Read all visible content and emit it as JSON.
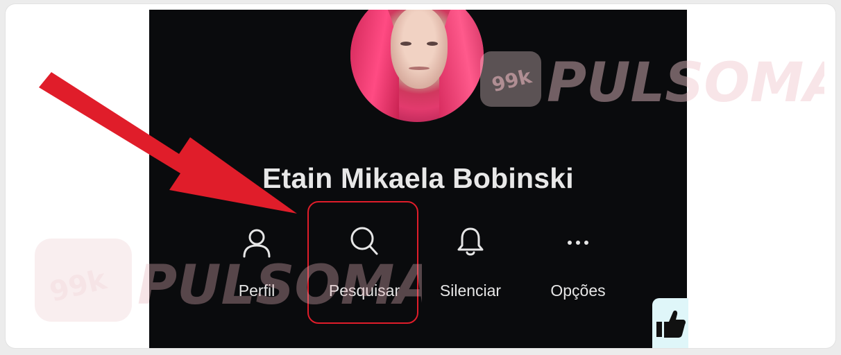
{
  "profile": {
    "name": "Etain Mikaela Bobinski"
  },
  "actions": [
    {
      "label": "Perfil",
      "icon": "person-icon"
    },
    {
      "label": "Pesquisar",
      "icon": "search-icon"
    },
    {
      "label": "Silenciar",
      "icon": "bell-icon"
    },
    {
      "label": "Opções",
      "icon": "more-dots-icon"
    }
  ],
  "watermark": {
    "brand": "PULSOMAX",
    "badge": "99k"
  },
  "colors": {
    "highlight": "#e01d2a",
    "arrow": "#e01d2a",
    "background": "#0a0b0d",
    "text": "#e6e6e6"
  }
}
